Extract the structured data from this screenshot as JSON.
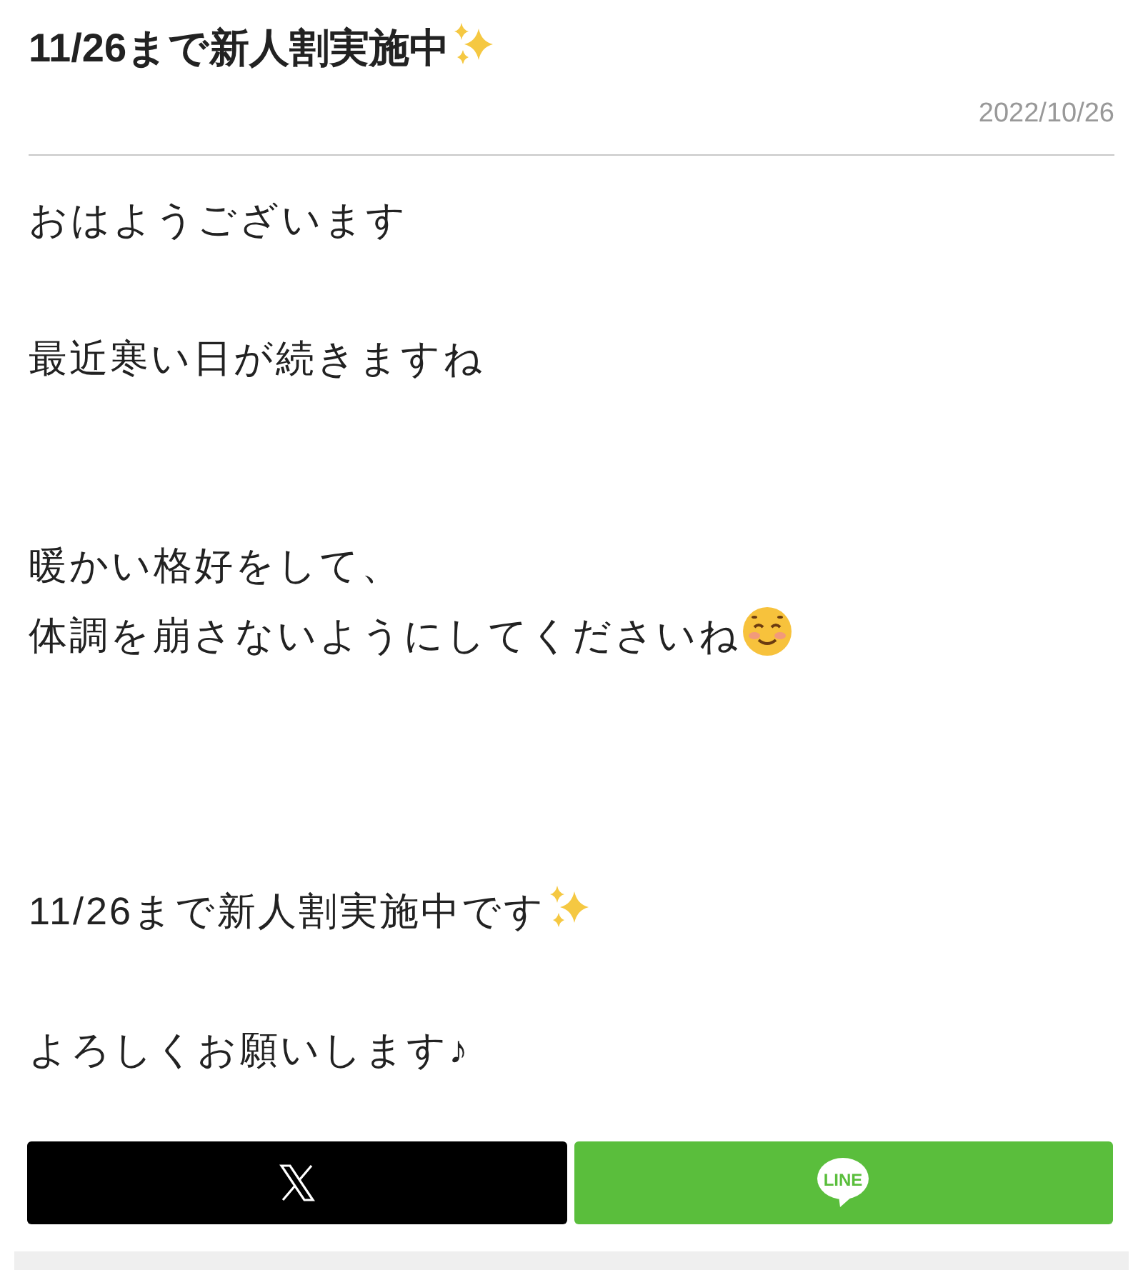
{
  "article": {
    "title": {
      "text": "11/26まで新人割実施中",
      "kind": "sparkles"
    },
    "date": "2022/10/26",
    "paragraphs": [
      [
        {
          "text": "おはようございます",
          "kind": "plain"
        }
      ],
      [
        {
          "text": "最近寒い日が続きますね",
          "kind": "plain"
        }
      ],
      [
        {
          "text": "暖かい格好をして、",
          "kind": "plain"
        },
        {
          "text": "体調を崩さないようにしてくださいね",
          "kind": "smile"
        }
      ],
      [
        {
          "text": "11/26まで新人割実施中です",
          "kind": "sparkles"
        }
      ],
      [
        {
          "text": "よろしくお願いします♪",
          "kind": "plain"
        }
      ]
    ]
  },
  "share_buttons": [
    {
      "kind": "x"
    },
    {
      "kind": "line",
      "logo_text": "LINE"
    }
  ]
}
